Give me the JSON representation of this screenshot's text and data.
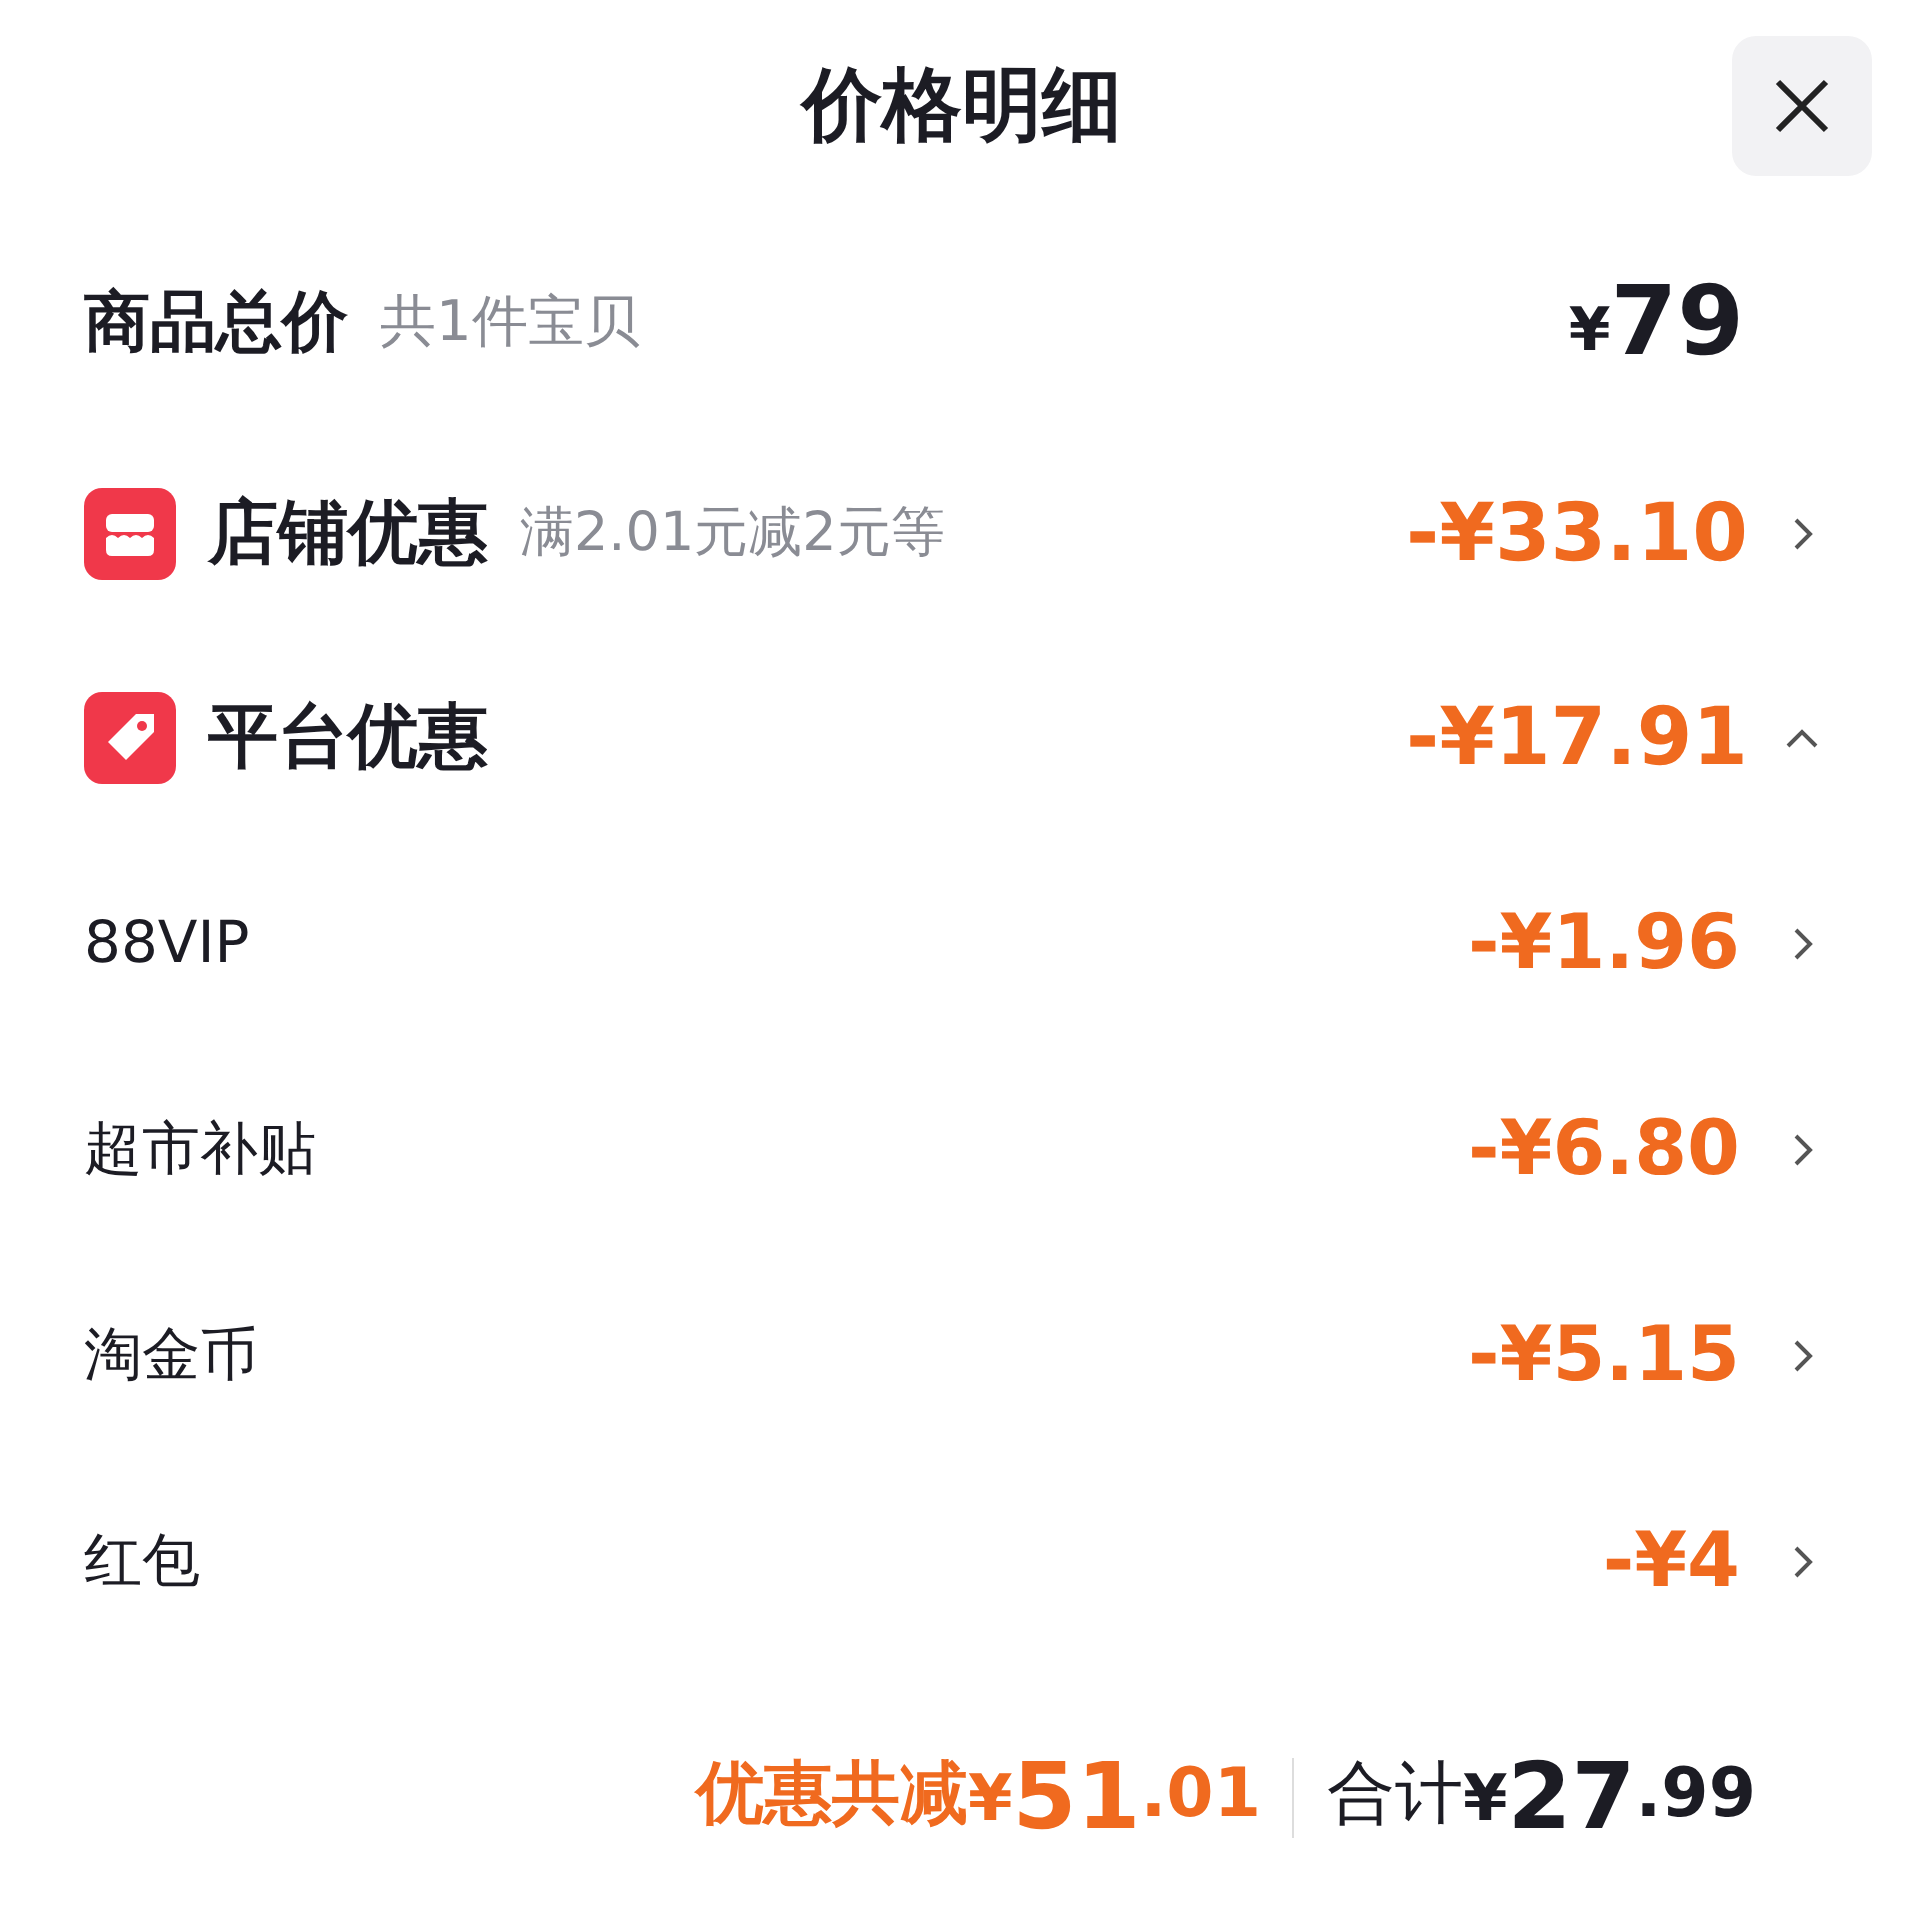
{
  "header": {
    "title": "价格明细"
  },
  "total": {
    "label": "商品总价",
    "note": "共1件宝贝",
    "currency": "¥",
    "value": "79"
  },
  "groups": [
    {
      "kind": "store",
      "label": "店铺优惠",
      "note": "满2.01元减2元等",
      "amount": "-¥33.10",
      "expanded": false
    },
    {
      "kind": "tag",
      "label": "平台优惠",
      "amount": "-¥17.91",
      "expanded": true,
      "children": [
        {
          "label": "88VIP",
          "amount": "-¥1.96"
        },
        {
          "label": "超市补贴",
          "amount": "-¥6.80"
        },
        {
          "label": "淘金币",
          "amount": "-¥5.15"
        },
        {
          "label": "红包",
          "amount": "-¥4"
        }
      ]
    }
  ],
  "footer": {
    "discount": {
      "label": "优惠共减",
      "currency": "¥",
      "whole": "51",
      "fraction": ".01"
    },
    "total": {
      "label": "合计",
      "currency": "¥",
      "whole": "27",
      "fraction": ".99"
    }
  }
}
